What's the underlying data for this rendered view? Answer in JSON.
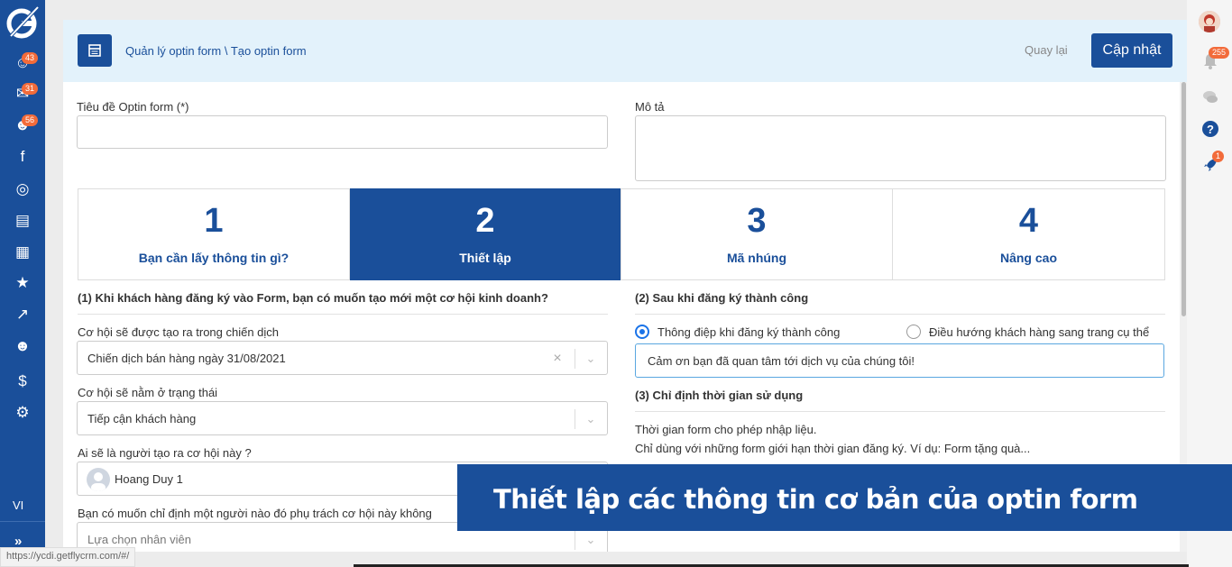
{
  "sidebar": {
    "items": [
      {
        "icon": "user-add-icon",
        "glyph": "☺",
        "badge": "43"
      },
      {
        "icon": "inbox-icon",
        "glyph": "✉",
        "badge": "31"
      },
      {
        "icon": "users-icon",
        "glyph": "☻",
        "badge": "56"
      },
      {
        "icon": "facebook-icon",
        "glyph": "f",
        "badge": ""
      },
      {
        "icon": "target-icon",
        "glyph": "◎",
        "badge": ""
      },
      {
        "icon": "cart-icon",
        "glyph": "▤",
        "badge": ""
      },
      {
        "icon": "cubes-icon",
        "glyph": "▦",
        "badge": ""
      },
      {
        "icon": "star-icon",
        "glyph": "★",
        "badge": ""
      },
      {
        "icon": "chart-icon",
        "glyph": "↗",
        "badge": ""
      },
      {
        "icon": "person-icon",
        "glyph": "☻",
        "badge": ""
      },
      {
        "icon": "dollar-icon",
        "glyph": "$",
        "badge": ""
      },
      {
        "icon": "gear-icon",
        "glyph": "⚙",
        "badge": ""
      }
    ],
    "language": "VI",
    "collapse_glyph": "»"
  },
  "rail": {
    "notification_badge": "255",
    "rocket_badge": "1"
  },
  "header": {
    "breadcrumb": "Quản lý optin form \\ Tạo optin form",
    "back_label": "Quay lại",
    "update_label": "Cập nhật"
  },
  "form": {
    "title_label": "Tiêu đề Optin form (*)",
    "title_value": "",
    "description_label": "Mô tả",
    "description_value": ""
  },
  "steps": [
    {
      "number": "1",
      "label": "Bạn cần lấy thông tin gì?",
      "active": false
    },
    {
      "number": "2",
      "label": "Thiết lập",
      "active": true
    },
    {
      "number": "3",
      "label": "Mã nhúng",
      "active": false
    },
    {
      "number": "4",
      "label": "Nâng cao",
      "active": false
    }
  ],
  "left_section": {
    "title": "(1) Khi khách hàng đăng ký vào Form, bạn có muốn tạo mới một cơ hội kinh doanh?",
    "campaign_label": "Cơ hội sẽ được tạo ra trong chiến dịch",
    "campaign_value": "Chiến dịch bán hàng ngày 31/08/2021",
    "status_label": "Cơ hội sẽ nằm ở trạng thái",
    "status_value": "Tiếp cận khách hàng",
    "creator_label": "Ai sẽ là người tạo ra cơ hội này ?",
    "creator_value": "Hoang Duy 1",
    "assignee_label": "Bạn có muốn chỉ định một người nào đó phụ trách cơ hội này không",
    "assignee_placeholder": "Lựa chọn nhân viên"
  },
  "right_section": {
    "title": "(2) Sau khi đăng ký thành công",
    "option_message": "Thông điệp khi đăng ký thành công",
    "option_redirect": "Điều hướng khách hàng sang trang cụ thể",
    "selected_option": "message",
    "message_value": "Cảm ơn bạn đã quan tâm tới dịch vụ của chúng tôi!",
    "time_title": "(3) Chỉ định thời gian sử dụng",
    "time_desc_1": "Thời gian form cho phép nhập liệu.",
    "time_desc_2": "Chỉ dùng với những form giới hạn thời gian đăng ký. Ví dụ: Form tặng quà..."
  },
  "banner": {
    "text": "Thiết lập các thông tin cơ bản của optin form"
  },
  "status_url": "https://ycdi.getflycrm.com/#/",
  "colors": {
    "primary": "#1a4f9a",
    "badge": "#f26b3a",
    "header_bg": "#e3f2fb"
  }
}
